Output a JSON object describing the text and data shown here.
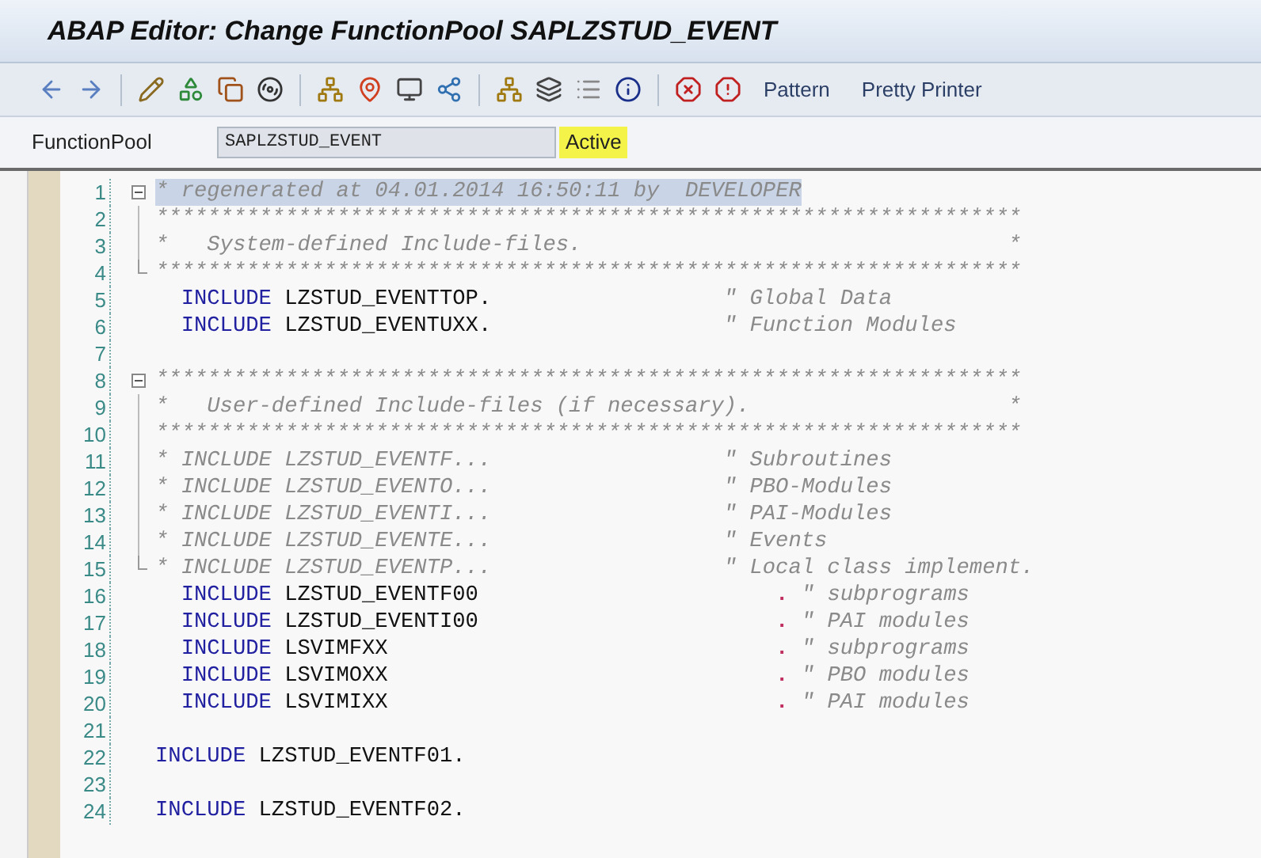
{
  "window": {
    "title": "ABAP Editor: Change FunctionPool SAPLZSTUD_EVENT"
  },
  "toolbar": {
    "buttons": [
      "Pattern",
      "Pretty Printer"
    ]
  },
  "header": {
    "label": "FunctionPool",
    "value": "SAPLZSTUD_EVENT",
    "status": "Active",
    "status_highlighted": true
  },
  "editor": {
    "lines": [
      {
        "number": "1",
        "kind": "foldstart",
        "highlighted": true,
        "indented": false,
        "parts": [
          {
            "kind": "comment",
            "text": "* regenerated at 04.01.2014 16:50:11 by  DEVELOPER"
          }
        ]
      },
      {
        "number": "2",
        "kind": "foldbody",
        "highlighted": false,
        "indented": false,
        "parts": [
          {
            "kind": "comment",
            "text": "*******************************************************************"
          }
        ]
      },
      {
        "number": "3",
        "kind": "foldbody",
        "highlighted": false,
        "indented": false,
        "parts": [
          {
            "kind": "comment",
            "text": "*   System-defined Include-files.                                 *"
          }
        ]
      },
      {
        "number": "4",
        "kind": "foldend",
        "highlighted": false,
        "indented": false,
        "parts": [
          {
            "kind": "comment",
            "text": "*******************************************************************"
          }
        ]
      },
      {
        "number": "5",
        "kind": "plain",
        "highlighted": false,
        "indented": true,
        "parts": [
          {
            "kind": "keyword",
            "text": "INCLUDE"
          },
          {
            "kind": "name",
            "text": "LZSTUD_EVENTTOP."
          }
        ],
        "comment": "\" Global Data"
      },
      {
        "number": "6",
        "kind": "plain",
        "highlighted": false,
        "indented": true,
        "parts": [
          {
            "kind": "keyword",
            "text": "INCLUDE"
          },
          {
            "kind": "name",
            "text": "LZSTUD_EVENTUXX."
          }
        ],
        "comment": "\" Function Modules"
      },
      {
        "number": "7",
        "kind": "plain"
      },
      {
        "number": "8",
        "kind": "foldstart",
        "highlighted": false,
        "indented": false,
        "parts": [
          {
            "kind": "comment",
            "text": "*******************************************************************"
          }
        ]
      },
      {
        "number": "9",
        "kind": "foldbody",
        "highlighted": false,
        "indented": false,
        "parts": [
          {
            "kind": "comment",
            "text": "*   User-defined Include-files (if necessary).                    *"
          }
        ]
      },
      {
        "number": "10",
        "kind": "foldbody",
        "highlighted": false,
        "indented": false,
        "parts": [
          {
            "kind": "comment",
            "text": "*******************************************************************"
          }
        ]
      },
      {
        "number": "11",
        "kind": "foldbody",
        "highlighted": false,
        "indented": false,
        "parts": [
          {
            "kind": "comment",
            "text": "* INCLUDE LZSTUD_EVENTF..."
          }
        ],
        "comment": "\" Subroutines"
      },
      {
        "number": "12",
        "kind": "foldbody",
        "highlighted": false,
        "indented": false,
        "parts": [
          {
            "kind": "comment",
            "text": "* INCLUDE LZSTUD_EVENTO..."
          }
        ],
        "comment": "\" PBO-Modules"
      },
      {
        "number": "13",
        "kind": "foldbody",
        "highlighted": false,
        "indented": false,
        "parts": [
          {
            "kind": "comment",
            "text": "* INCLUDE LZSTUD_EVENTI..."
          }
        ],
        "comment": "\" PAI-Modules"
      },
      {
        "number": "14",
        "kind": "foldbody",
        "highlighted": false,
        "indented": false,
        "parts": [
          {
            "kind": "comment",
            "text": "* INCLUDE LZSTUD_EVENTE..."
          }
        ],
        "comment": "\" Events"
      },
      {
        "number": "15",
        "kind": "foldend",
        "highlighted": false,
        "indented": false,
        "parts": [
          {
            "kind": "comment",
            "text": "* INCLUDE LZSTUD_EVENTP..."
          }
        ],
        "comment": "\" Local class implement."
      },
      {
        "number": "16",
        "kind": "plain",
        "highlighted": false,
        "indented": true,
        "parts": [
          {
            "kind": "keyword",
            "text": "INCLUDE"
          },
          {
            "kind": "name",
            "text": "LZSTUD_EVENTF00"
          }
        ],
        "period": ".",
        "comment": "\" subprograms"
      },
      {
        "number": "17",
        "kind": "plain",
        "highlighted": false,
        "indented": true,
        "parts": [
          {
            "kind": "keyword",
            "text": "INCLUDE"
          },
          {
            "kind": "name",
            "text": "LZSTUD_EVENTI00"
          }
        ],
        "period": ".",
        "comment": "\" PAI modules"
      },
      {
        "number": "18",
        "kind": "plain",
        "highlighted": false,
        "indented": true,
        "parts": [
          {
            "kind": "keyword",
            "text": "INCLUDE"
          },
          {
            "kind": "name",
            "text": "LSVIMFXX"
          }
        ],
        "period": ".",
        "comment": "\" subprograms"
      },
      {
        "number": "19",
        "kind": "plain",
        "highlighted": false,
        "indented": true,
        "parts": [
          {
            "kind": "keyword",
            "text": "INCLUDE"
          },
          {
            "kind": "name",
            "text": "LSVIMOXX"
          }
        ],
        "period": ".",
        "comment": "\" PBO modules"
      },
      {
        "number": "20",
        "kind": "plain",
        "highlighted": false,
        "indented": true,
        "parts": [
          {
            "kind": "keyword",
            "text": "INCLUDE"
          },
          {
            "kind": "name",
            "text": "LSVIMIXX"
          }
        ],
        "period": ".",
        "comment": "\" PAI modules"
      },
      {
        "number": "21",
        "kind": "plain"
      },
      {
        "number": "22",
        "kind": "plain",
        "highlighted": false,
        "indented": false,
        "parts": [
          {
            "kind": "keyword",
            "text": "INCLUDE"
          },
          {
            "kind": "name",
            "text": "LZSTUD_EVENTF01."
          }
        ]
      },
      {
        "number": "23",
        "kind": "plain"
      },
      {
        "number": "24",
        "kind": "plain",
        "highlighted": false,
        "indented": false,
        "parts": [
          {
            "kind": "keyword",
            "text": "INCLUDE"
          },
          {
            "kind": "name",
            "text": "LZSTUD_EVENTF02."
          }
        ]
      }
    ]
  }
}
